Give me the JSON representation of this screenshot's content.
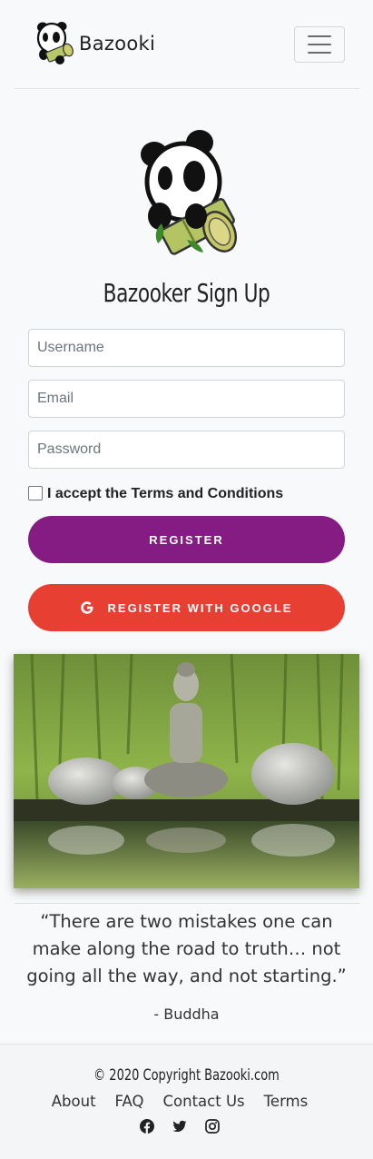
{
  "navbar": {
    "brand_name": "Bazooki",
    "logo_icon": "panda-bazooka-icon",
    "menu_icon": "hamburger-menu-icon"
  },
  "signup": {
    "title": "Bazooker Sign Up",
    "username_placeholder": "Username",
    "email_placeholder": "Email",
    "password_placeholder": "Password",
    "terms_label": "I accept the Terms and Conditions",
    "register_label": "REGISTER",
    "google_label": "REGISTER WITH GOOGLE",
    "google_icon": "google-icon"
  },
  "quote": {
    "text": "“There are two mistakes one can make along the road to truth… not going all the way, and not starting.”",
    "author": "- Buddha"
  },
  "footer": {
    "copyright": "© 2020 Copyright Bazooki.com",
    "links": [
      "About",
      "FAQ",
      "Contact Us",
      "Terms"
    ],
    "social_icons": [
      "facebook-icon",
      "twitter-icon",
      "instagram-icon"
    ]
  },
  "colors": {
    "register": "#841c84",
    "google": "#e83f33",
    "background": "#f8f9fa"
  }
}
